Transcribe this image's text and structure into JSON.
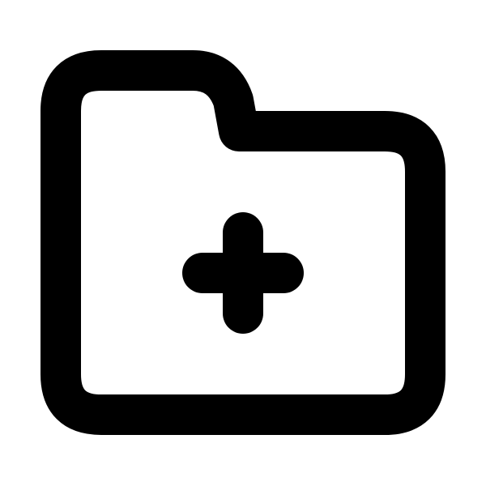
{
  "icon": {
    "name": "folder-add-icon",
    "color": "#000000",
    "background": "#ffffff"
  }
}
